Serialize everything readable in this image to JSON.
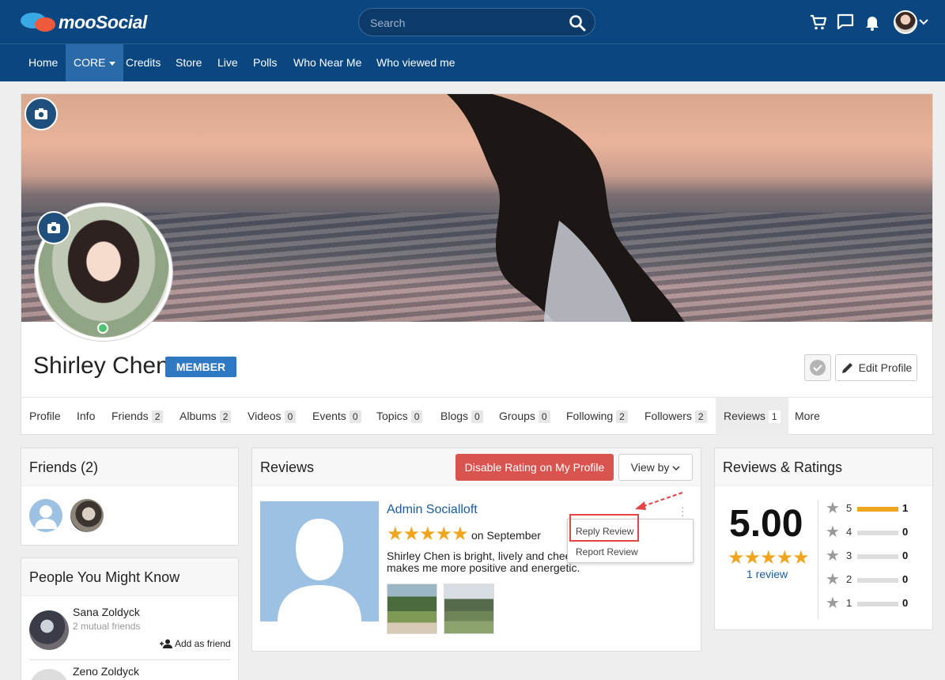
{
  "header": {
    "logo_text": "mooSocial",
    "search_placeholder": "Search",
    "icons": [
      "cart-icon",
      "chat-icon",
      "bell-icon",
      "avatar",
      "chevron-down-icon"
    ]
  },
  "nav": [
    {
      "label": "Home"
    },
    {
      "label": "CORE"
    },
    {
      "label": "Credits"
    },
    {
      "label": "Store"
    },
    {
      "label": "Live"
    },
    {
      "label": "Polls"
    },
    {
      "label": "Who Near Me"
    },
    {
      "label": "Who viewed me"
    }
  ],
  "profile": {
    "name": "Shirley Chen",
    "badge": "MEMBER",
    "edit_label": "Edit Profile",
    "online": true
  },
  "tabs": [
    {
      "label": "Profile",
      "count": ""
    },
    {
      "label": "Info",
      "count": ""
    },
    {
      "label": "Friends",
      "count": "2"
    },
    {
      "label": "Albums",
      "count": "2"
    },
    {
      "label": "Videos",
      "count": "0"
    },
    {
      "label": "Events",
      "count": "0"
    },
    {
      "label": "Topics",
      "count": "0"
    },
    {
      "label": "Blogs",
      "count": "0"
    },
    {
      "label": "Groups",
      "count": "0"
    },
    {
      "label": "Following",
      "count": "2"
    },
    {
      "label": "Followers",
      "count": "2"
    },
    {
      "label": "Reviews",
      "count": "1"
    },
    {
      "label": "More",
      "count": ""
    }
  ],
  "friends": {
    "title": "Friends (2)"
  },
  "pymk": {
    "title": "People You Might Know",
    "people": [
      {
        "name": "Sana Zoldyck",
        "mutual": "2 mutual friends",
        "action": "Add as friend"
      },
      {
        "name": "Zeno Zoldyck"
      }
    ]
  },
  "reviews": {
    "title": "Reviews",
    "disable_label": "Disable Rating on My Profile",
    "viewby_label": "View by",
    "item": {
      "author": "Admin Socialloft",
      "rating": 5,
      "date": "on September 09 20",
      "text": "Shirley Chen is bright, lively and chee over 1 year, makes me more positive and energetic."
    },
    "menu": [
      "Reply Review",
      "Report Review"
    ]
  },
  "ratings": {
    "title": "Reviews & Ratings",
    "score": "5.00",
    "review_count": "1 review",
    "rows": [
      {
        "star": "5",
        "count": "1",
        "fraction": 1.0
      },
      {
        "star": "4",
        "count": "0",
        "fraction": 0
      },
      {
        "star": "3",
        "count": "0",
        "fraction": 0
      },
      {
        "star": "2",
        "count": "0",
        "fraction": 0
      },
      {
        "star": "1",
        "count": "0",
        "fraction": 0
      }
    ]
  },
  "colors": {
    "header_bg": "#0a4680",
    "accent": "#2f78c2",
    "danger": "#d9534f",
    "star": "#f0a51e",
    "link": "#1b5b9c"
  }
}
